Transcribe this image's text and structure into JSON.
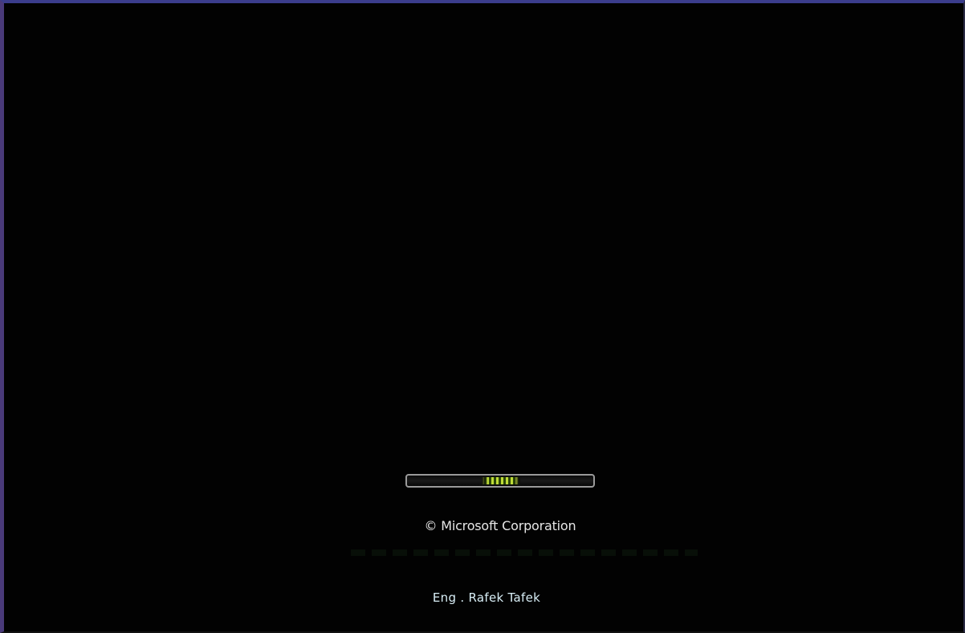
{
  "boot_screen": {
    "copyright": "© Microsoft Corporation",
    "author": "Eng . Rafek Tafek",
    "progress": {
      "state": "indeterminate",
      "accent_color": "#c8e63a"
    },
    "background_color": "#000000",
    "frame_color": "#3b3d8c"
  }
}
